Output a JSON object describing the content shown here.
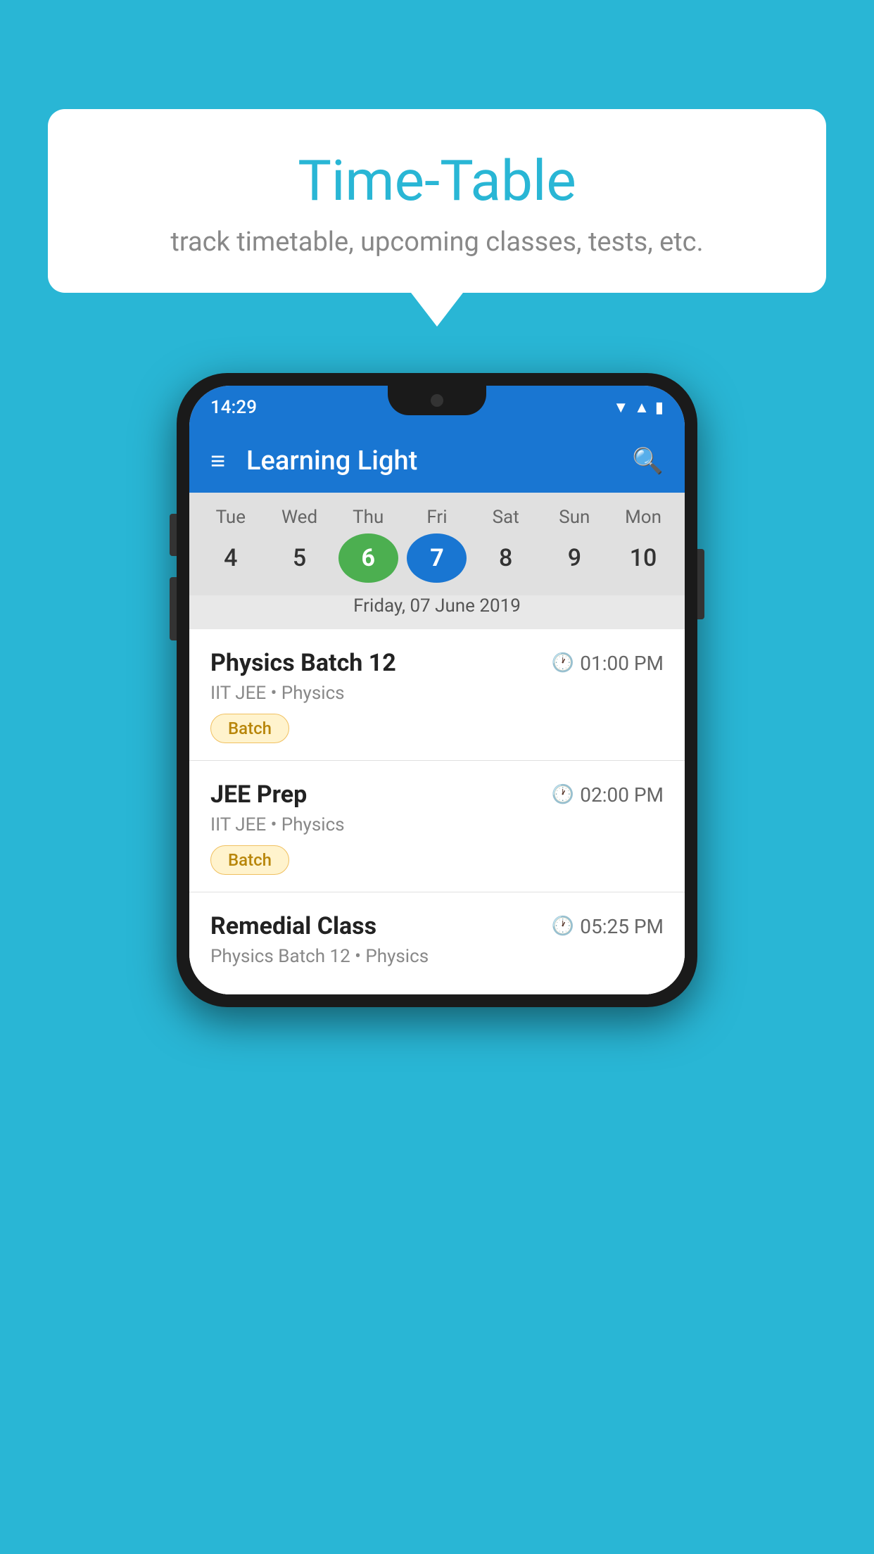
{
  "background_color": "#29B6D5",
  "speech_bubble": {
    "title": "Time-Table",
    "subtitle": "track timetable, upcoming classes, tests, etc."
  },
  "phone": {
    "status_bar": {
      "time": "14:29"
    },
    "app_bar": {
      "title": "Learning Light"
    },
    "calendar": {
      "days": [
        {
          "label": "Tue",
          "number": "4"
        },
        {
          "label": "Wed",
          "number": "5"
        },
        {
          "label": "Thu",
          "number": "6",
          "state": "today"
        },
        {
          "label": "Fri",
          "number": "7",
          "state": "selected"
        },
        {
          "label": "Sat",
          "number": "8"
        },
        {
          "label": "Sun",
          "number": "9"
        },
        {
          "label": "Mon",
          "number": "10"
        }
      ],
      "selected_date_label": "Friday, 07 June 2019"
    },
    "schedule": [
      {
        "title": "Physics Batch 12",
        "time": "01:00 PM",
        "subtitle": "IIT JEE • Physics",
        "badge": "Batch"
      },
      {
        "title": "JEE Prep",
        "time": "02:00 PM",
        "subtitle": "IIT JEE • Physics",
        "badge": "Batch"
      },
      {
        "title": "Remedial Class",
        "time": "05:25 PM",
        "subtitle": "Physics Batch 12 • Physics",
        "badge": ""
      }
    ]
  }
}
